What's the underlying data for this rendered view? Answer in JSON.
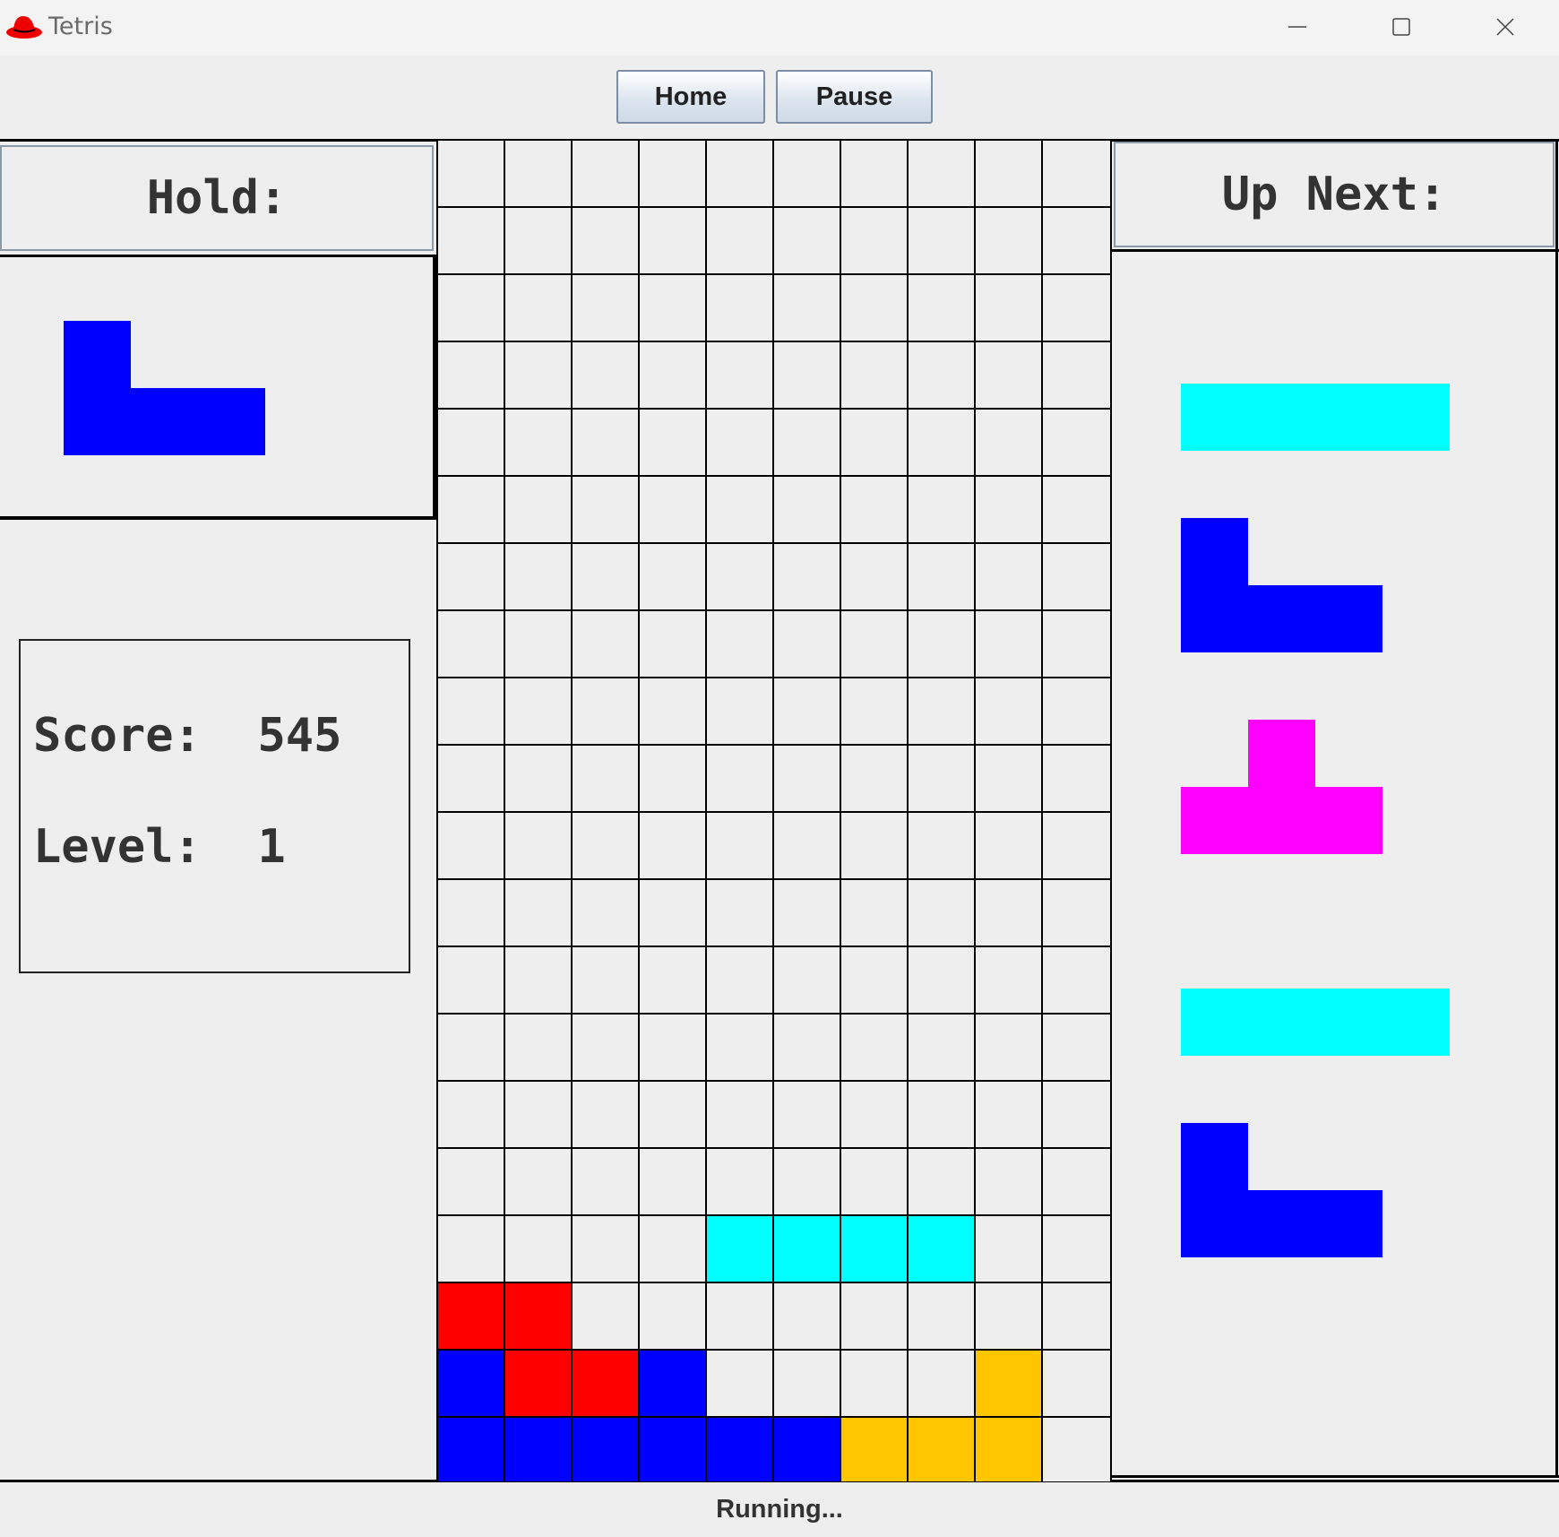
{
  "window": {
    "title": "Tetris",
    "icon": "redhat-icon"
  },
  "toolbar": {
    "home_label": "Home",
    "pause_label": "Pause"
  },
  "hold": {
    "header": "Hold:",
    "piece": "J",
    "color": "#0000ff"
  },
  "stats": {
    "score_label": "Score:",
    "score_value": "545",
    "level_label": "Level:",
    "level_value": "1"
  },
  "up_next": {
    "header": "Up Next:",
    "pieces": [
      {
        "shape": "I",
        "color": "#00ffff"
      },
      {
        "shape": "J",
        "color": "#0000ff"
      },
      {
        "shape": "T",
        "color": "#ff00ff"
      },
      {
        "shape": "I",
        "color": "#00ffff"
      },
      {
        "shape": "J",
        "color": "#0000ff"
      }
    ]
  },
  "board": {
    "columns": 10,
    "rows": 20,
    "empty_color": "#eeeeee",
    "palette": {
      "I": "#00ffff",
      "J": "#0000ff",
      "T": "#ff00ff",
      "Z": "#ff0000",
      "L": "#ffc600"
    },
    "grid": [
      "..........",
      "..........",
      "..........",
      "..........",
      "..........",
      "..........",
      "..........",
      "..........",
      "..........",
      "..........",
      "..........",
      "..........",
      "..........",
      "..........",
      "..........",
      "..........",
      "....IIII..",
      "ZZ........",
      "JZZJ....L.",
      "JJJJJJLLL."
    ]
  },
  "status": {
    "text": "Running..."
  }
}
